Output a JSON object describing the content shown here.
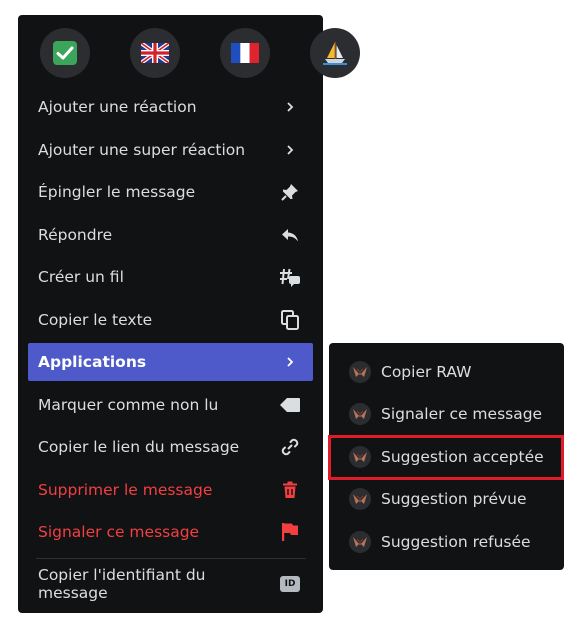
{
  "reactions": [
    {
      "icon": "check-mark-icon",
      "color": "#3ba55c"
    },
    {
      "icon": "uk-flag-icon"
    },
    {
      "icon": "france-flag-icon"
    },
    {
      "icon": "sailboat-icon"
    }
  ],
  "menu": {
    "items": [
      {
        "label": "Ajouter une réaction",
        "icon": "chevron-right-icon"
      },
      {
        "label": "Ajouter une super réaction",
        "icon": "chevron-right-icon"
      },
      {
        "label": "Épingler le message",
        "icon": "pin-icon"
      },
      {
        "label": "Répondre",
        "icon": "reply-icon"
      },
      {
        "label": "Créer un fil",
        "icon": "thread-icon"
      },
      {
        "label": "Copier le texte",
        "icon": "copy-icon"
      },
      {
        "label": "Applications",
        "icon": "chevron-right-icon",
        "active": true
      },
      {
        "label": "Marquer comme non lu",
        "icon": "unread-icon"
      },
      {
        "label": "Copier le lien du message",
        "icon": "link-icon"
      },
      {
        "label": "Supprimer le message",
        "icon": "trash-icon",
        "danger": true
      },
      {
        "label": "Signaler ce message",
        "icon": "flag-icon",
        "danger": true
      },
      {
        "label": "Copier l'identifiant du message",
        "icon": "id-icon",
        "badge": "ID"
      }
    ]
  },
  "submenu": {
    "items": [
      {
        "label": "Copier RAW"
      },
      {
        "label": "Signaler ce message"
      },
      {
        "label": "Suggestion acceptée",
        "highlighted": true
      },
      {
        "label": "Suggestion prévue"
      },
      {
        "label": "Suggestion refusée"
      }
    ]
  },
  "colors": {
    "menu_bg": "#111214",
    "active_bg": "#4e5ac9",
    "danger": "#f23f42",
    "highlight_border": "#e01b2a"
  }
}
